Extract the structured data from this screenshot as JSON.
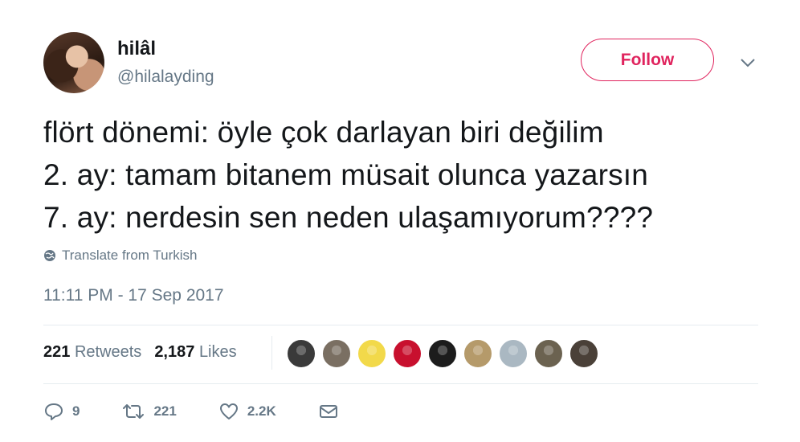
{
  "user": {
    "display_name": "hilâl",
    "handle": "@hilalayding"
  },
  "follow_label": "Follow",
  "tweet": {
    "lines": [
      "flört dönemi: öyle çok darlayan biri değilim",
      "2. ay: tamam bitanem müsait olunca yazarsın",
      "7. ay: nerdesin sen neden ulaşamıyorum????"
    ],
    "translate_label": "Translate from Turkish",
    "timestamp": "11:11 PM - 17 Sep 2017"
  },
  "stats": {
    "retweets_count": "221",
    "retweets_label": "Retweets",
    "likes_count": "2,187",
    "likes_label": "Likes"
  },
  "liked_by_avatar_colors": [
    "#3a3a3a",
    "#7a6f62",
    "#f2d94a",
    "#c8102e",
    "#1c1c1c",
    "#b59a6a",
    "#aab8c2",
    "#6b6250",
    "#4a4038"
  ],
  "actions": {
    "reply_count": "9",
    "retweet_count": "221",
    "like_count": "2.2K"
  },
  "colors": {
    "accent": "#e0245e",
    "muted": "#657786",
    "text": "#14171a"
  }
}
